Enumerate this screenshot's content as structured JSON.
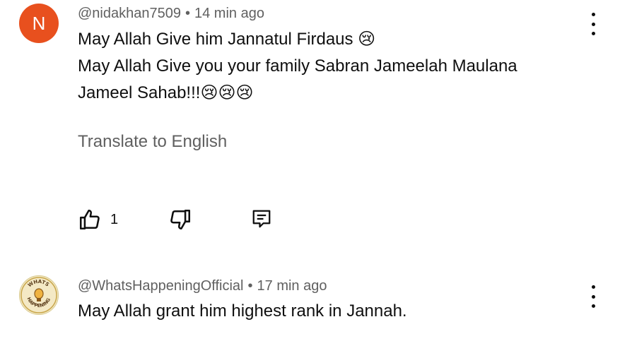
{
  "comments": [
    {
      "avatar_letter": "N",
      "avatar_color": "#e8501e",
      "author": "@nidakhan7509",
      "separator": "•",
      "time": "14 min ago",
      "lines": [
        "May Allah Give him Jannatul Firdaus 😢",
        "May Allah Give you your family  Sabran Jameelah Maulana",
        "Jameel Sahab!!!😢😢😢"
      ],
      "translate_label": "Translate to English",
      "like_count": "1"
    },
    {
      "avatar_text": "WHATS HAPPENING",
      "author": "@WhatsHappeningOfficial",
      "separator": "•",
      "time": "17 min ago",
      "lines": [
        "May Allah grant him highest rank in Jannah."
      ]
    }
  ]
}
